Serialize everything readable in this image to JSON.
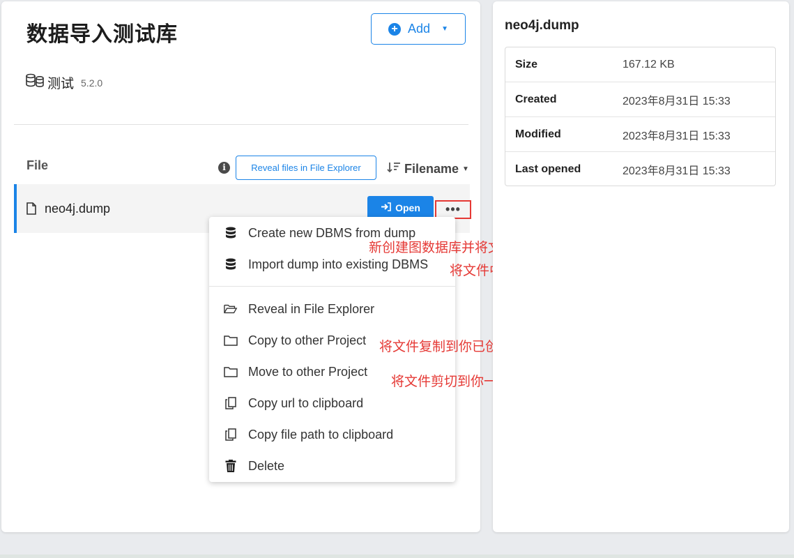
{
  "project": {
    "title": "数据导入测试库",
    "add_label": "Add",
    "database": {
      "name": "测试",
      "version": "5.2.0",
      "icon": "database-stack-icon"
    }
  },
  "files": {
    "header": "File",
    "reveal_label": "Reveal files in File Explorer",
    "sort_label": "Filename",
    "rows": [
      {
        "name": "neo4j.dump",
        "open_label": "Open",
        "more_label": "•••"
      }
    ]
  },
  "context_menu": {
    "items": [
      {
        "label": "Create new DBMS from dump",
        "icon": "database-icon"
      },
      {
        "label": "Import dump into existing DBMS",
        "icon": "database-icon"
      },
      {
        "label": "Reveal in File Explorer",
        "icon": "folder-open-icon"
      },
      {
        "label": "Copy to other Project",
        "icon": "folder-icon"
      },
      {
        "label": "Move to other Project",
        "icon": "folder-icon"
      },
      {
        "label": "Copy url to clipboard",
        "icon": "copy-icon"
      },
      {
        "label": "Copy file path to clipboard",
        "icon": "copy-icon"
      },
      {
        "label": "Delete",
        "icon": "trash-icon"
      }
    ]
  },
  "annotations": {
    "create_new": "新创建图数据库并将文件中的数据自动导入到你将创建的图数据库中",
    "import_existing": "将文件中的数据导入到你已创建的图数据库中",
    "copy_to_project": "将文件复制到你已创建的项目中的File界面下",
    "move_to_project": "将文件剪切到你一创建的项目中的File界面下"
  },
  "details": {
    "title": "neo4j.dump",
    "rows": [
      {
        "label": "Size",
        "value": "167.12 KB"
      },
      {
        "label": "Created",
        "value": "2023年8月31日 15:33"
      },
      {
        "label": "Modified",
        "value": "2023年8月31日 15:33"
      },
      {
        "label": "Last opened",
        "value": "2023年8月31日 15:33"
      }
    ]
  },
  "colors": {
    "accent": "#1b84e7",
    "annotation": "#e53935",
    "highlight_box": "#e53935"
  }
}
